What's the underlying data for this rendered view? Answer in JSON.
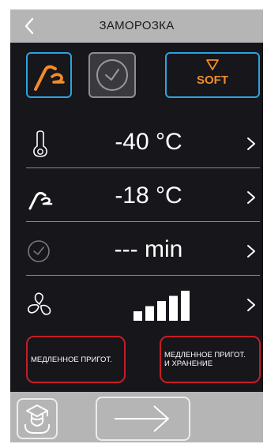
{
  "header": {
    "title": "ЗАМОРОЗКА",
    "back_icon": "chevron-left-icon"
  },
  "modes": {
    "probe_icon": "core-probe-icon",
    "timer_icon": "clock-icon",
    "soft_icon": "triangle-down-icon",
    "soft_label": "SOFT",
    "probe_selected": true,
    "soft_selected": true
  },
  "settings": {
    "chamber_temp": {
      "icon": "thermometer-icon",
      "value": "-40 °C"
    },
    "probe_temp": {
      "icon": "core-probe-icon",
      "value": "-18 °C"
    },
    "time": {
      "icon": "clock-icon",
      "value": "--- min"
    },
    "fan": {
      "icon": "fan-icon",
      "level": 5,
      "max_level": 5
    }
  },
  "programs": {
    "slow_cook": "МЕДЛЕННОЕ ПРИГОТ.",
    "slow_cook_hold": "МЕДЛЕННОЕ ПРИГОТ.\nИ ХРАНЕНИЕ"
  },
  "footer": {
    "chef_icon": "chef-icon",
    "next_icon": "arrow-right-icon"
  },
  "colors": {
    "background": "#16161b",
    "header": "#b5b5b5",
    "accent_orange": "#f28c28",
    "accent_blue": "#2da3dd",
    "accent_red": "#c41e24"
  }
}
